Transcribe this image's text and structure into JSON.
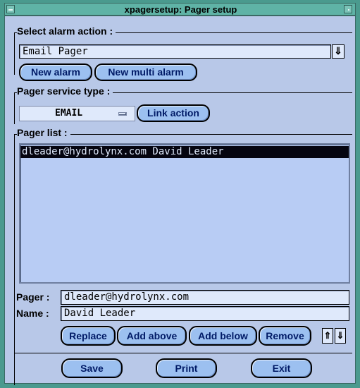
{
  "window": {
    "title": "xpagersetup: Pager setup"
  },
  "alarm_action": {
    "group_label": "Select alarm action :",
    "selected": "Email Pager",
    "new_alarm_label": "New alarm",
    "new_multi_alarm_label": "New multi alarm"
  },
  "service_type": {
    "group_label": "Pager service type :",
    "selected": "EMAIL",
    "link_action_label": "Link action"
  },
  "pager_list": {
    "group_label": "Pager list :",
    "items": [
      "dleader@hydrolynx.com David Leader"
    ]
  },
  "form": {
    "pager_label": "Pager :",
    "pager_value": "dleader@hydrolynx.com",
    "name_label": "Name :",
    "name_value": "David Leader"
  },
  "list_actions": {
    "replace_label": "Replace",
    "add_above_label": "Add above",
    "add_below_label": "Add below",
    "remove_label": "Remove",
    "move_up_glyph": "⇑",
    "move_down_glyph": "⇓"
  },
  "footer": {
    "save_label": "Save",
    "print_label": "Print",
    "exit_label": "Exit"
  },
  "dropdown_arrow_glyph": "⇓"
}
